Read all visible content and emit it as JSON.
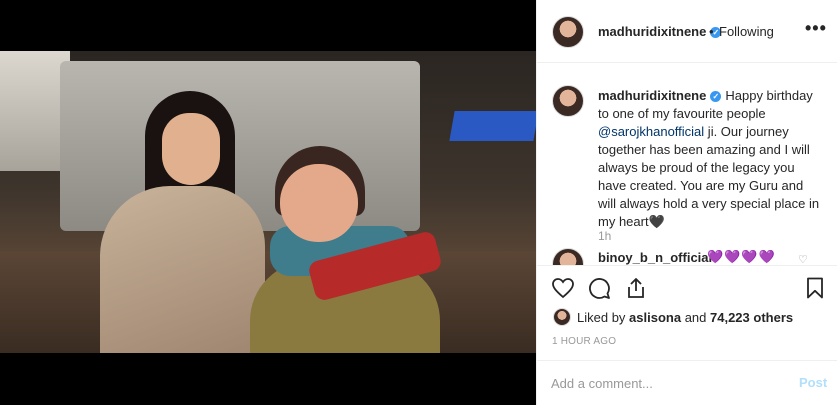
{
  "post": {
    "username": "madhuridixitnene",
    "follow_status": "Following",
    "more_label": "•••",
    "verified_mark": "✓"
  },
  "caption": {
    "username": "madhuridixitnene",
    "text_before": "Happy birthday to one of my favourite people ",
    "mention": "@sarojkhanofficial",
    "text_after": " ji. Our journey together has been amazing and I will always be proud of the legacy you have created. You are my Guru and will always hold a very special place in my heart🖤",
    "age": "1h"
  },
  "comment2": {
    "username": "binoy_b_n_official",
    "text": "💜💜💜💜"
  },
  "actions": {
    "icons": [
      "heart-icon",
      "comment-icon",
      "share-icon",
      "bookmark-icon"
    ]
  },
  "likes": {
    "prefix": "Liked by ",
    "user": "aslisona",
    "middle": " and ",
    "count": "74,223 others"
  },
  "timestamp": "1 HOUR AGO",
  "add_comment": {
    "placeholder": "Add a comment...",
    "post_label": "Post"
  },
  "colors": {
    "verified": "#3897f0",
    "mention": "#003569",
    "post_button": "#b2dffc"
  }
}
